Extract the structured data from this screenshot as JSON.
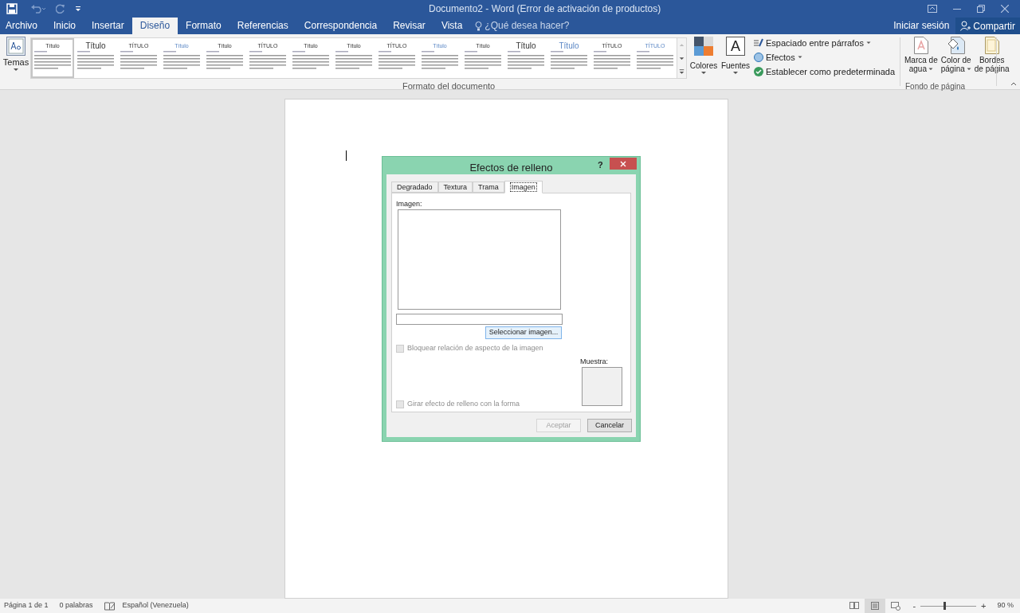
{
  "window": {
    "title": "Documento2 - Word (Error de activación de productos)"
  },
  "menu_tabs": [
    {
      "label": "Archivo",
      "selected": false
    },
    {
      "label": "Inicio",
      "selected": false
    },
    {
      "label": "Insertar",
      "selected": false
    },
    {
      "label": "Diseño",
      "selected": true
    },
    {
      "label": "Formato",
      "selected": false
    },
    {
      "label": "Referencias",
      "selected": false
    },
    {
      "label": "Correspondencia",
      "selected": false
    },
    {
      "label": "Revisar",
      "selected": false
    },
    {
      "label": "Vista",
      "selected": false
    }
  ],
  "tell_me": {
    "placeholder": "¿Qué desea hacer?"
  },
  "sign_in": "Iniciar sesión",
  "share": "Compartir",
  "ribbon": {
    "themes": "Temas",
    "style_gallery": [
      {
        "heading": "Título",
        "selected": true
      },
      {
        "heading": "Título",
        "selected": false
      },
      {
        "heading": "TÍTULO",
        "selected": false
      },
      {
        "heading": "Título",
        "selected": false
      },
      {
        "heading": "Título",
        "selected": false
      },
      {
        "heading": "TÍTULO",
        "selected": false
      },
      {
        "heading": "Título",
        "selected": false
      },
      {
        "heading": "Título",
        "selected": false
      },
      {
        "heading": "TÍTULO",
        "selected": false
      },
      {
        "heading": "Título",
        "selected": false
      },
      {
        "heading": "Título",
        "selected": false
      },
      {
        "heading": "Título",
        "selected": false
      },
      {
        "heading": "Título",
        "selected": false
      },
      {
        "heading": "TÍTULO",
        "selected": false
      },
      {
        "heading": "TÍTULO",
        "selected": false
      }
    ],
    "colors": "Colores",
    "fonts_glyph": "A",
    "fonts": "Fuentes",
    "paragraph_spacing": "Espaciado entre párrafos",
    "effects": "Efectos",
    "set_default": "Establecer como predeterminada",
    "group_document": "Formato del documento",
    "watermark": [
      "Marca de",
      "agua"
    ],
    "page_color": [
      "Color de",
      "página"
    ],
    "page_borders": [
      "Bordes",
      "de página"
    ],
    "group_background": "Fondo de página"
  },
  "dialog": {
    "title": "Efectos de relleno",
    "help": "?",
    "tabs": [
      {
        "label": "Degradado",
        "selected": false
      },
      {
        "label": "Textura",
        "selected": false
      },
      {
        "label": "Trama",
        "selected": false
      },
      {
        "label": "Imagen",
        "selected": true
      }
    ],
    "image_label": "Imagen:",
    "select_button": "Seleccionar imagen...",
    "checkboxes": [
      {
        "label": "Bloquear relación de aspecto de la imagen",
        "checked": false,
        "disabled": true
      },
      {
        "label": "Girar efecto de relleno con la forma",
        "checked": false,
        "disabled": true
      }
    ],
    "sample_label": "Muestra:",
    "buttons": [
      {
        "label": "Aceptar",
        "disabled": true
      },
      {
        "label": "Cancelar",
        "disabled": false
      }
    ]
  },
  "status_bar": {
    "page": "Página 1 de 1",
    "words": "0 palabras",
    "language": "Español (Venezuela)",
    "views": [
      {
        "selected": false
      },
      {
        "selected": true
      },
      {
        "selected": false
      }
    ],
    "zoom_minus": "-",
    "zoom_plus": "+",
    "zoom": {
      "level": 0.43
    },
    "zoom_reading": "90 %"
  }
}
